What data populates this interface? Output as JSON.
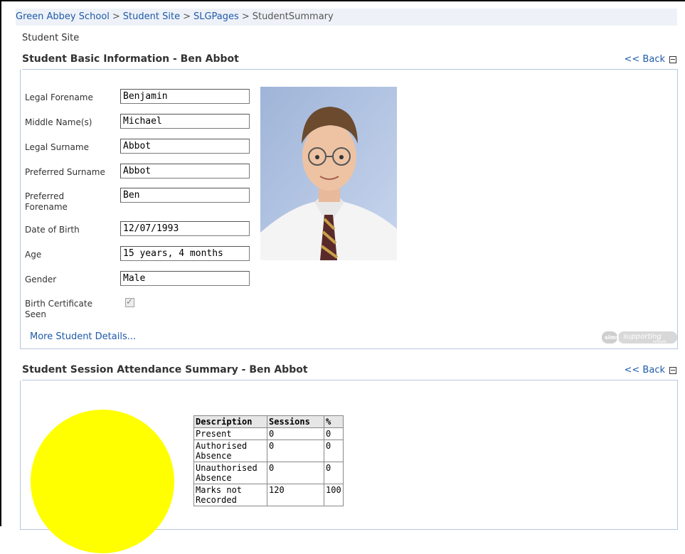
{
  "breadcrumb": {
    "items": [
      "Green Abbey School",
      "Student Site",
      "SLGPages"
    ],
    "separator": ">",
    "current": "StudentSummary"
  },
  "site_title": "Student Site",
  "basic_info": {
    "title": "Student Basic Information - Ben Abbot",
    "back_label": "<< Back",
    "fields": {
      "legal_forename": {
        "label": "Legal Forename",
        "value": "Benjamin"
      },
      "middle_names": {
        "label": "Middle Name(s)",
        "value": "Michael"
      },
      "legal_surname": {
        "label": "Legal Surname",
        "value": "Abbot"
      },
      "preferred_surname": {
        "label": "Preferred Surname",
        "value": "Abbot"
      },
      "preferred_forename": {
        "label": "Preferred Forename",
        "value": "Ben"
      },
      "date_of_birth": {
        "label": "Date of Birth",
        "value": "12/07/1993"
      },
      "age": {
        "label": "Age",
        "value": "15 years, 4 months"
      },
      "gender": {
        "label": "Gender",
        "value": "Male"
      },
      "birth_certificate": {
        "label": "Birth Certificate Seen",
        "checked": true
      }
    },
    "more_details_link": "More Student Details...",
    "logo": {
      "left_text": "sims",
      "right_text": "supporting",
      "sub_text": "schools"
    }
  },
  "attendance": {
    "title": "Student Session Attendance Summary - Ben Abbot",
    "back_label": "<< Back",
    "pie_color": "#ffff00",
    "columns": [
      "Description",
      "Sessions",
      "%"
    ],
    "rows": [
      {
        "description": "Present",
        "sessions": "0",
        "percent": "0"
      },
      {
        "description": "Authorised Absence",
        "sessions": "0",
        "percent": "0"
      },
      {
        "description": "Unauthorised Absence",
        "sessions": "0",
        "percent": "0"
      },
      {
        "description": "Marks not Recorded",
        "sessions": "120",
        "percent": "100"
      }
    ]
  },
  "colors": {
    "link": "#1f5aa8",
    "panel_border": "#b5c6dd",
    "breadcrumb_bg": "#eef2f8"
  }
}
